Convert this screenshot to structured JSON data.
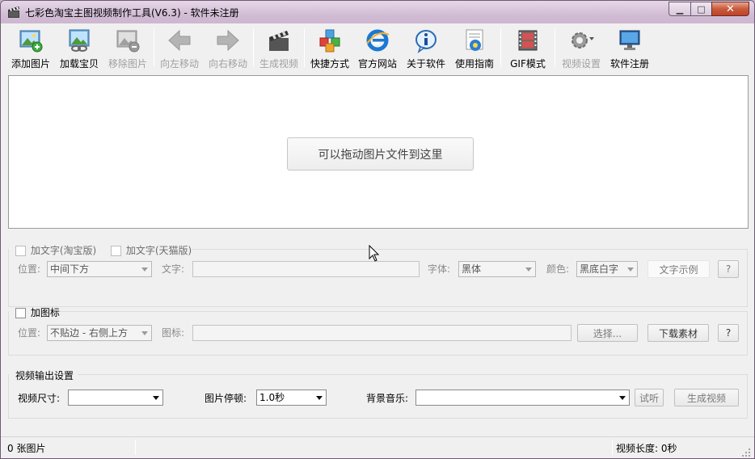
{
  "window": {
    "title": "七彩色淘宝主图视频制作工具(V6.3) - 软件未注册",
    "controls": {
      "minimize": "▁",
      "maximize": "□",
      "close": "✕"
    }
  },
  "toolbar": [
    {
      "id": "add-image",
      "label": "添加图片",
      "icon": "add-image-icon",
      "enabled": true
    },
    {
      "id": "load-product",
      "label": "加载宝贝",
      "icon": "load-product-icon",
      "enabled": true
    },
    {
      "id": "remove-image",
      "label": "移除图片",
      "icon": "remove-image-icon",
      "enabled": false
    },
    {
      "id": "move-left",
      "label": "向左移动",
      "icon": "arrow-left-icon",
      "enabled": false
    },
    {
      "id": "move-right",
      "label": "向右移动",
      "icon": "arrow-right-icon",
      "enabled": false
    },
    {
      "id": "generate-video",
      "label": "生成视频",
      "icon": "clapperboard-icon",
      "enabled": false
    },
    {
      "id": "shortcut",
      "label": "快捷方式",
      "icon": "cubes-icon",
      "enabled": true
    },
    {
      "id": "website",
      "label": "官方网站",
      "icon": "ie-browser-icon",
      "enabled": true
    },
    {
      "id": "about",
      "label": "关于软件",
      "icon": "info-icon",
      "enabled": true
    },
    {
      "id": "guide",
      "label": "使用指南",
      "icon": "help-document-icon",
      "enabled": true
    },
    {
      "id": "gif-mode",
      "label": "GIF模式",
      "icon": "film-icon",
      "enabled": true
    },
    {
      "id": "video-settings",
      "label": "视频设置",
      "icon": "gear-icon",
      "enabled": false
    },
    {
      "id": "register",
      "label": "软件注册",
      "icon": "monitor-icon",
      "enabled": true
    }
  ],
  "drop_area": {
    "hint": "可以拖动图片文件到这里"
  },
  "text_section": {
    "taobao_checkbox": "加文字(淘宝版)",
    "tmall_checkbox": "加文字(天猫版)",
    "position_label": "位置:",
    "position_value": "中间下方",
    "text_label": "文字:",
    "text_value": "",
    "font_label": "字体:",
    "font_value": "黑体",
    "color_label": "颜色:",
    "color_value": "黑底白字",
    "sample_button": "文字示例",
    "help_button": "?"
  },
  "icon_section": {
    "checkbox": "加图标",
    "position_label": "位置:",
    "position_value": "不贴边 - 右侧上方",
    "icon_label": "图标:",
    "icon_value": "",
    "choose_button": "选择...",
    "download_button": "下载素材",
    "help_button": "?"
  },
  "output_section": {
    "title": "视频输出设置",
    "size_label": "视频尺寸:",
    "size_value": "",
    "pause_label": "图片停顿:",
    "pause_value": "1.0秒",
    "music_label": "背景音乐:",
    "music_value": "",
    "listen_button": "试听",
    "generate_button": "生成视频"
  },
  "status_bar": {
    "image_count": "0 张图片",
    "video_length": "视频长度: 0秒"
  }
}
